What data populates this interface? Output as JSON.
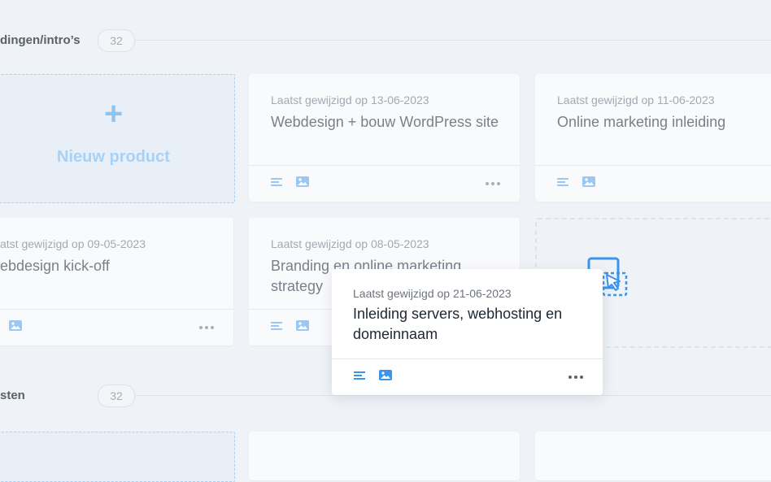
{
  "sections": [
    {
      "title": "dingen/intro’s",
      "count": "32"
    },
    {
      "title": "sten",
      "count": "32"
    }
  ],
  "new_product": {
    "plus": "+",
    "label": "Nieuw product"
  },
  "cards": [
    {
      "date": "Laatst gewijzigd op 13-06-2023",
      "title": "Webdesign + bouw WordPress site"
    },
    {
      "date": "Laatst gewijzigd op 11-06-2023",
      "title": "Online marketing inleiding"
    },
    {
      "date": "atst gewijzigd op 09-05-2023",
      "title": "ebdesign kick-off"
    },
    {
      "date": "Laatst gewijzigd op 08-05-2023",
      "title": "Branding en online marketing strategy"
    }
  ],
  "dragged_card": {
    "date": "Laatst gewijzigd op 21-06-2023",
    "title": "Inleiding servers, webhosting en domeinnaam"
  },
  "icons": {
    "text": "text-lines-icon",
    "image": "image-icon",
    "more": "more-dots-icon",
    "drop": "drag-drop-cursor-icon"
  },
  "colors": {
    "accent": "#3a95ee",
    "accent_light": "#9ac8f2",
    "background": "#eff2f6",
    "card": "#f9fafc"
  }
}
